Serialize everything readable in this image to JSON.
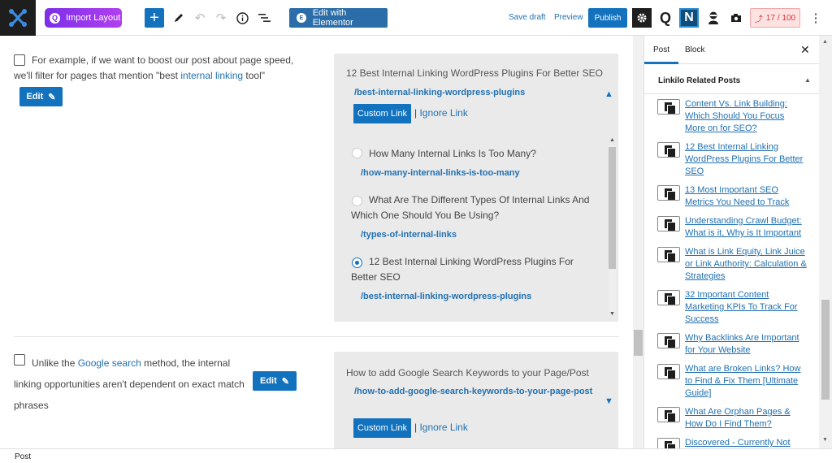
{
  "toolbar": {
    "import_label": "Import Layout",
    "elementor_label": "Edit with Elementor",
    "save_draft": "Save draft",
    "preview": "Preview",
    "publish": "Publish",
    "score": "17 / 100"
  },
  "editor": {
    "block1": {
      "text_before": "For example, if we want to boost our post about page speed, we'll filter for pages that mention \"best ",
      "link_text": "internal linking",
      "text_after": " tool\"",
      "edit_label": "Edit"
    },
    "panel1": {
      "title": "12 Best Internal Linking WordPress Plugins For Better SEO",
      "url": "/best-internal-linking-wordpress-plugins",
      "custom_link": "Custom Link",
      "separator": "|",
      "ignore_link": "Ignore Link",
      "options": [
        {
          "title": "How Many Internal Links Is Too Many?",
          "url": "/how-many-internal-links-is-too-many",
          "selected": false
        },
        {
          "title": "What Are The Different Types Of Internal Links And Which One Should You Be Using?",
          "url": "/types-of-internal-links",
          "selected": false
        },
        {
          "title": "12 Best Internal Linking WordPress Plugins For Better SEO",
          "url": "/best-internal-linking-wordpress-plugins",
          "selected": true
        }
      ]
    },
    "block2": {
      "text_before": "Unlike the ",
      "link_text": "Google search",
      "text_after": " method, the internal linking opportunities aren't dependent on exact match phrases",
      "edit_label": "Edit"
    },
    "panel2": {
      "title": "How to add Google Search Keywords to your Page/Post",
      "url": "/how-to-add-google-search-keywords-to-your-page-post",
      "custom_link": "Custom Link",
      "separator": "|",
      "ignore_link": "Ignore Link"
    }
  },
  "sidebar": {
    "tabs": [
      "Post",
      "Block"
    ],
    "section_title": "Linkilo Related Posts",
    "related_posts": [
      "Content Vs. Link Building: Which Should You Focus More on for SEO?",
      "12 Best Internal Linking WordPress Plugins For Better SEO",
      "13 Most Important SEO Metrics You Need to Track",
      "Understanding Crawl Budget: What is it, Why is It Important",
      "What is Link Equity, Link Juice or Link Authority: Calculation & Strategies",
      "32 Important Content Marketing KPIs To Track For Success",
      "Why Backlinks Are Important for Your Website",
      "What are Broken Links? How to Find & Fix Them [Ultimate Guide]",
      "What Are Orphan Pages & How Do I Find Them?",
      "Discovered - Currently Not"
    ]
  },
  "footer": {
    "breadcrumb": "Post"
  },
  "colors": {
    "accent": "#1272be",
    "link": "#2271b1",
    "score_red": "#d63638"
  }
}
